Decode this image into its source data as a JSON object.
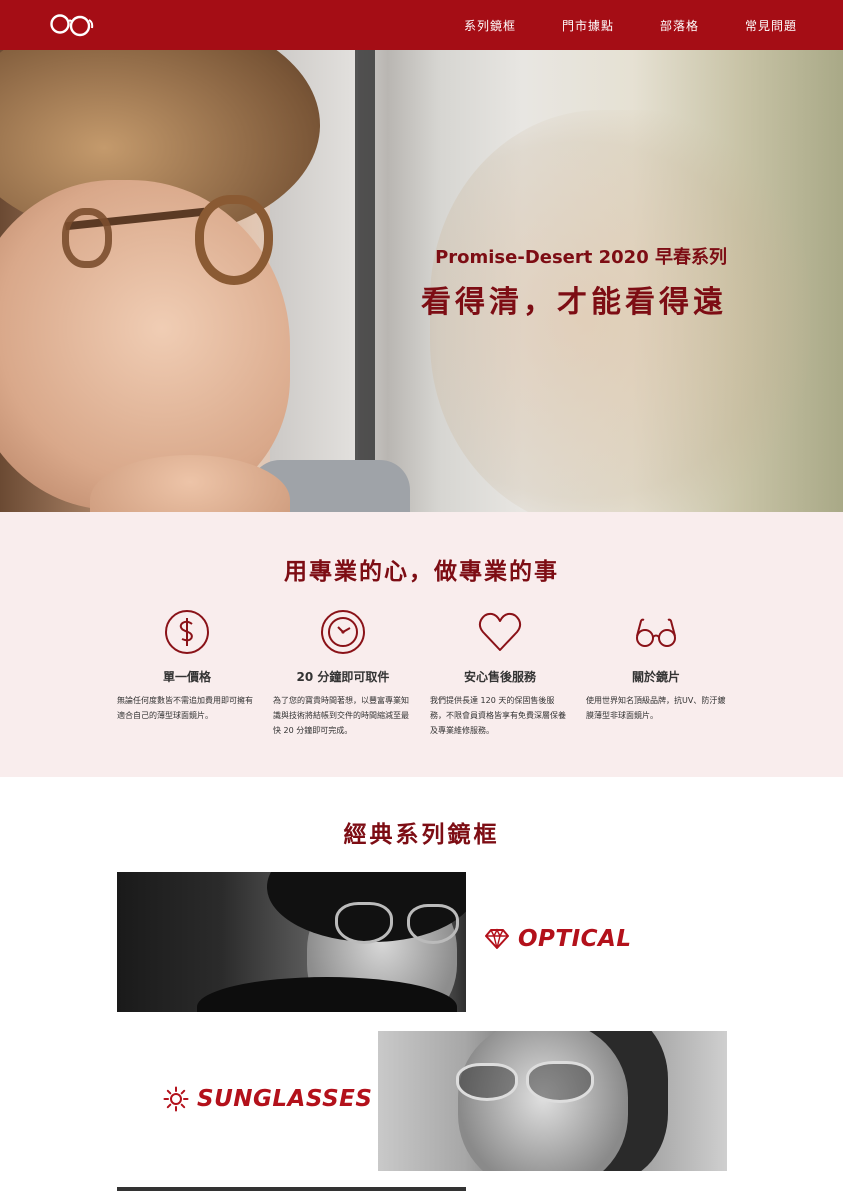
{
  "nav": {
    "logo_icon": "glasses-logo-icon",
    "items": [
      "系列鏡框",
      "門市據點",
      "部落格",
      "常見問題"
    ]
  },
  "hero": {
    "subtitle": "Promise-Desert 2020 早春系列",
    "title": "看得清，才能看得遠"
  },
  "features": {
    "title": "用專業的心，做專業的事",
    "items": [
      {
        "icon": "dollar-icon",
        "title": "單一價格",
        "desc": "無論任何度數皆不需追加費用即可擁有適合自己的薄型球面鏡片。"
      },
      {
        "icon": "clock-icon",
        "title": "20 分鐘即可取件",
        "desc": "為了您的寶貴時間著想，以豐富專業知識與技術將結帳到交件的時間縮減至最快 20 分鐘即可完成。"
      },
      {
        "icon": "heart-icon",
        "title": "安心售後服務",
        "desc": "我們提供長達 120 天的保固售後服務，不限會員資格皆享有免費深層保養及專業維修服務。"
      },
      {
        "icon": "glasses-icon",
        "title": "關於鏡片",
        "desc": "使用世界知名頂級品牌，抗UV、防汙鍍膜薄型非球面鏡片。"
      }
    ]
  },
  "collection": {
    "title": "經典系列鏡框",
    "optical_label": "OPTICAL",
    "optical_icon": "diamond-icon",
    "sun_label": "SUNGLASSES",
    "sun_icon": "sun-icon"
  },
  "colors": {
    "brand": "#a50d15",
    "accent_text": "#7d0d14",
    "features_bg": "#f9eded"
  }
}
